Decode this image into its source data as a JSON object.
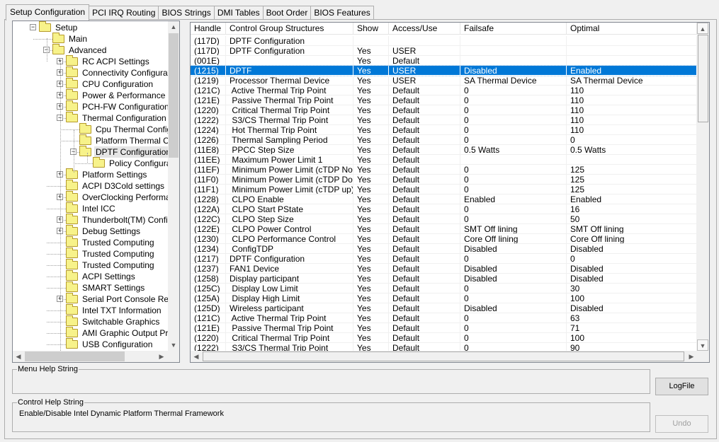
{
  "tabs": [
    "Setup Configuration",
    "PCI IRQ Routing",
    "BIOS Strings",
    "DMI Tables",
    "Boot Order",
    "BIOS Features"
  ],
  "active_tab": 0,
  "tree": [
    {
      "label": "Setup",
      "level": 1,
      "exp": "minus"
    },
    {
      "label": "Main",
      "level": 2,
      "exp": ""
    },
    {
      "label": "Advanced",
      "level": 2,
      "exp": "minus"
    },
    {
      "label": "RC ACPI Settings",
      "level": 3,
      "exp": "plus"
    },
    {
      "label": "Connectivity Configuration",
      "level": 3,
      "exp": "plus"
    },
    {
      "label": "CPU Configuration",
      "level": 3,
      "exp": "plus"
    },
    {
      "label": "Power & Performance",
      "level": 3,
      "exp": "plus"
    },
    {
      "label": "PCH-FW Configuration",
      "level": 3,
      "exp": "plus"
    },
    {
      "label": "Thermal Configuration",
      "level": 3,
      "exp": "minus"
    },
    {
      "label": "Cpu Thermal Configur",
      "level": 4,
      "exp": ""
    },
    {
      "label": "Platform Thermal Con",
      "level": 4,
      "exp": ""
    },
    {
      "label": "DPTF Configuration",
      "level": 4,
      "exp": "minus",
      "selected": true
    },
    {
      "label": "Policy Configuratio",
      "level": 5,
      "exp": ""
    },
    {
      "label": "Platform Settings",
      "level": 3,
      "exp": "plus"
    },
    {
      "label": "ACPI D3Cold settings",
      "level": 3,
      "exp": ""
    },
    {
      "label": "OverClocking Performanc",
      "level": 3,
      "exp": "plus"
    },
    {
      "label": "Intel ICC",
      "level": 3,
      "exp": ""
    },
    {
      "label": "Thunderbolt(TM) Configur",
      "level": 3,
      "exp": "plus"
    },
    {
      "label": "Debug Settings",
      "level": 3,
      "exp": "plus"
    },
    {
      "label": "Trusted Computing",
      "level": 3,
      "exp": ""
    },
    {
      "label": "Trusted Computing",
      "level": 3,
      "exp": ""
    },
    {
      "label": "Trusted Computing",
      "level": 3,
      "exp": ""
    },
    {
      "label": "ACPI Settings",
      "level": 3,
      "exp": ""
    },
    {
      "label": "SMART Settings",
      "level": 3,
      "exp": ""
    },
    {
      "label": "Serial Port Console Redire",
      "level": 3,
      "exp": "plus"
    },
    {
      "label": "Intel TXT Information",
      "level": 3,
      "exp": ""
    },
    {
      "label": "Switchable Graphics",
      "level": 3,
      "exp": ""
    },
    {
      "label": "AMI Graphic Output Proto",
      "level": 3,
      "exp": ""
    },
    {
      "label": "USB Configuration",
      "level": 3,
      "exp": ""
    }
  ],
  "table": {
    "columns": [
      "Handle",
      "Control Group Structures",
      "Show",
      "Access/Use",
      "Failsafe",
      "Optimal"
    ],
    "selected_row": 3,
    "rows": [
      [
        "(117D)",
        "DPTF Configuration",
        "",
        "",
        "",
        ""
      ],
      [
        "(117D)",
        "DPTF Configuration",
        "Yes",
        "USER",
        "",
        ""
      ],
      [
        "(001E)",
        "",
        "Yes",
        "Default",
        "",
        ""
      ],
      [
        "(1215)",
        "DPTF",
        "Yes",
        "USER",
        "Disabled",
        "Enabled"
      ],
      [
        "(1219)",
        "Processor Thermal Device",
        "Yes",
        "USER",
        "SA Thermal Device",
        "SA Thermal Device"
      ],
      [
        "(121C)",
        " Active Thermal Trip Point",
        "Yes",
        "Default",
        "0",
        "110"
      ],
      [
        "(121E)",
        " Passive Thermal Trip Point",
        "Yes",
        "Default",
        "0",
        "110"
      ],
      [
        "(1220)",
        " Critical Thermal Trip Point",
        "Yes",
        "Default",
        "0",
        "110"
      ],
      [
        "(1222)",
        " S3/CS Thermal Trip Point",
        "Yes",
        "Default",
        "0",
        "110"
      ],
      [
        "(1224)",
        " Hot Thermal Trip Point",
        "Yes",
        "Default",
        "0",
        "110"
      ],
      [
        "(1226)",
        " Thermal Sampling Period",
        "Yes",
        "Default",
        "0",
        "0"
      ],
      [
        "(11E8)",
        " PPCC Step Size",
        "Yes",
        "Default",
        "0.5 Watts",
        "0.5 Watts"
      ],
      [
        "(11EE)",
        " Maximum Power Limit 1",
        "Yes",
        "Default",
        "",
        ""
      ],
      [
        "(11EF)",
        " Minimum Power Limit (cTDP Nom)",
        "Yes",
        "Default",
        "0",
        "125"
      ],
      [
        "(11F0)",
        " Minimum Power Limit (cTDP Do...",
        "Yes",
        "Default",
        "0",
        "125"
      ],
      [
        "(11F1)",
        " Minimum Power Limit (cTDP up)",
        "Yes",
        "Default",
        "0",
        "125"
      ],
      [
        "(1228)",
        " CLPO Enable",
        "Yes",
        "Default",
        "Enabled",
        "Enabled"
      ],
      [
        "(122A)",
        " CLPO Start PState",
        "Yes",
        "Default",
        "0",
        "16"
      ],
      [
        "(122C)",
        " CLPO Step Size",
        "Yes",
        "Default",
        "0",
        "50"
      ],
      [
        "(122E)",
        " CLPO Power Control",
        "Yes",
        "Default",
        "SMT Off lining",
        "SMT Off lining"
      ],
      [
        "(1230)",
        " CLPO Performance Control",
        "Yes",
        "Default",
        "Core Off lining",
        "Core Off lining"
      ],
      [
        "(1234)",
        " ConfigTDP",
        "Yes",
        "Default",
        "Disabled",
        "Disabled"
      ],
      [
        "(1217)",
        "DPTF Configuration",
        "Yes",
        "Default",
        "0",
        "0"
      ],
      [
        "(1237)",
        "FAN1 Device",
        "Yes",
        "Default",
        "Disabled",
        "Disabled"
      ],
      [
        "(1258)",
        "Display participant",
        "Yes",
        "Default",
        "Disabled",
        "Disabled"
      ],
      [
        "(125C)",
        " Display Low Limit",
        "Yes",
        "Default",
        "0",
        "30"
      ],
      [
        "(125A)",
        " Display High Limit",
        "Yes",
        "Default",
        "0",
        "100"
      ],
      [
        "(125D)",
        "Wireless participant",
        "Yes",
        "Default",
        "Disabled",
        "Disabled"
      ],
      [
        "(121C)",
        " Active Thermal Trip Point",
        "Yes",
        "Default",
        "0",
        "63"
      ],
      [
        "(121E)",
        " Passive Thermal Trip Point",
        "Yes",
        "Default",
        "0",
        "71"
      ],
      [
        "(1220)",
        " Critical Thermal Trip Point",
        "Yes",
        "Default",
        "0",
        "100"
      ],
      [
        "(1222)",
        " S3/CS Thermal Trip Point",
        "Yes",
        "Default",
        "0",
        "90"
      ]
    ]
  },
  "menu_help": {
    "label": "Menu Help String",
    "text": ""
  },
  "control_help": {
    "label": "Control Help String",
    "text": "Enable/Disable Intel Dynamic Platform Thermal Framework"
  },
  "buttons": {
    "logfile": "LogFile",
    "undo": "Undo"
  },
  "colors": {
    "selection": "#0078d7",
    "folder": "#f7f28a"
  }
}
